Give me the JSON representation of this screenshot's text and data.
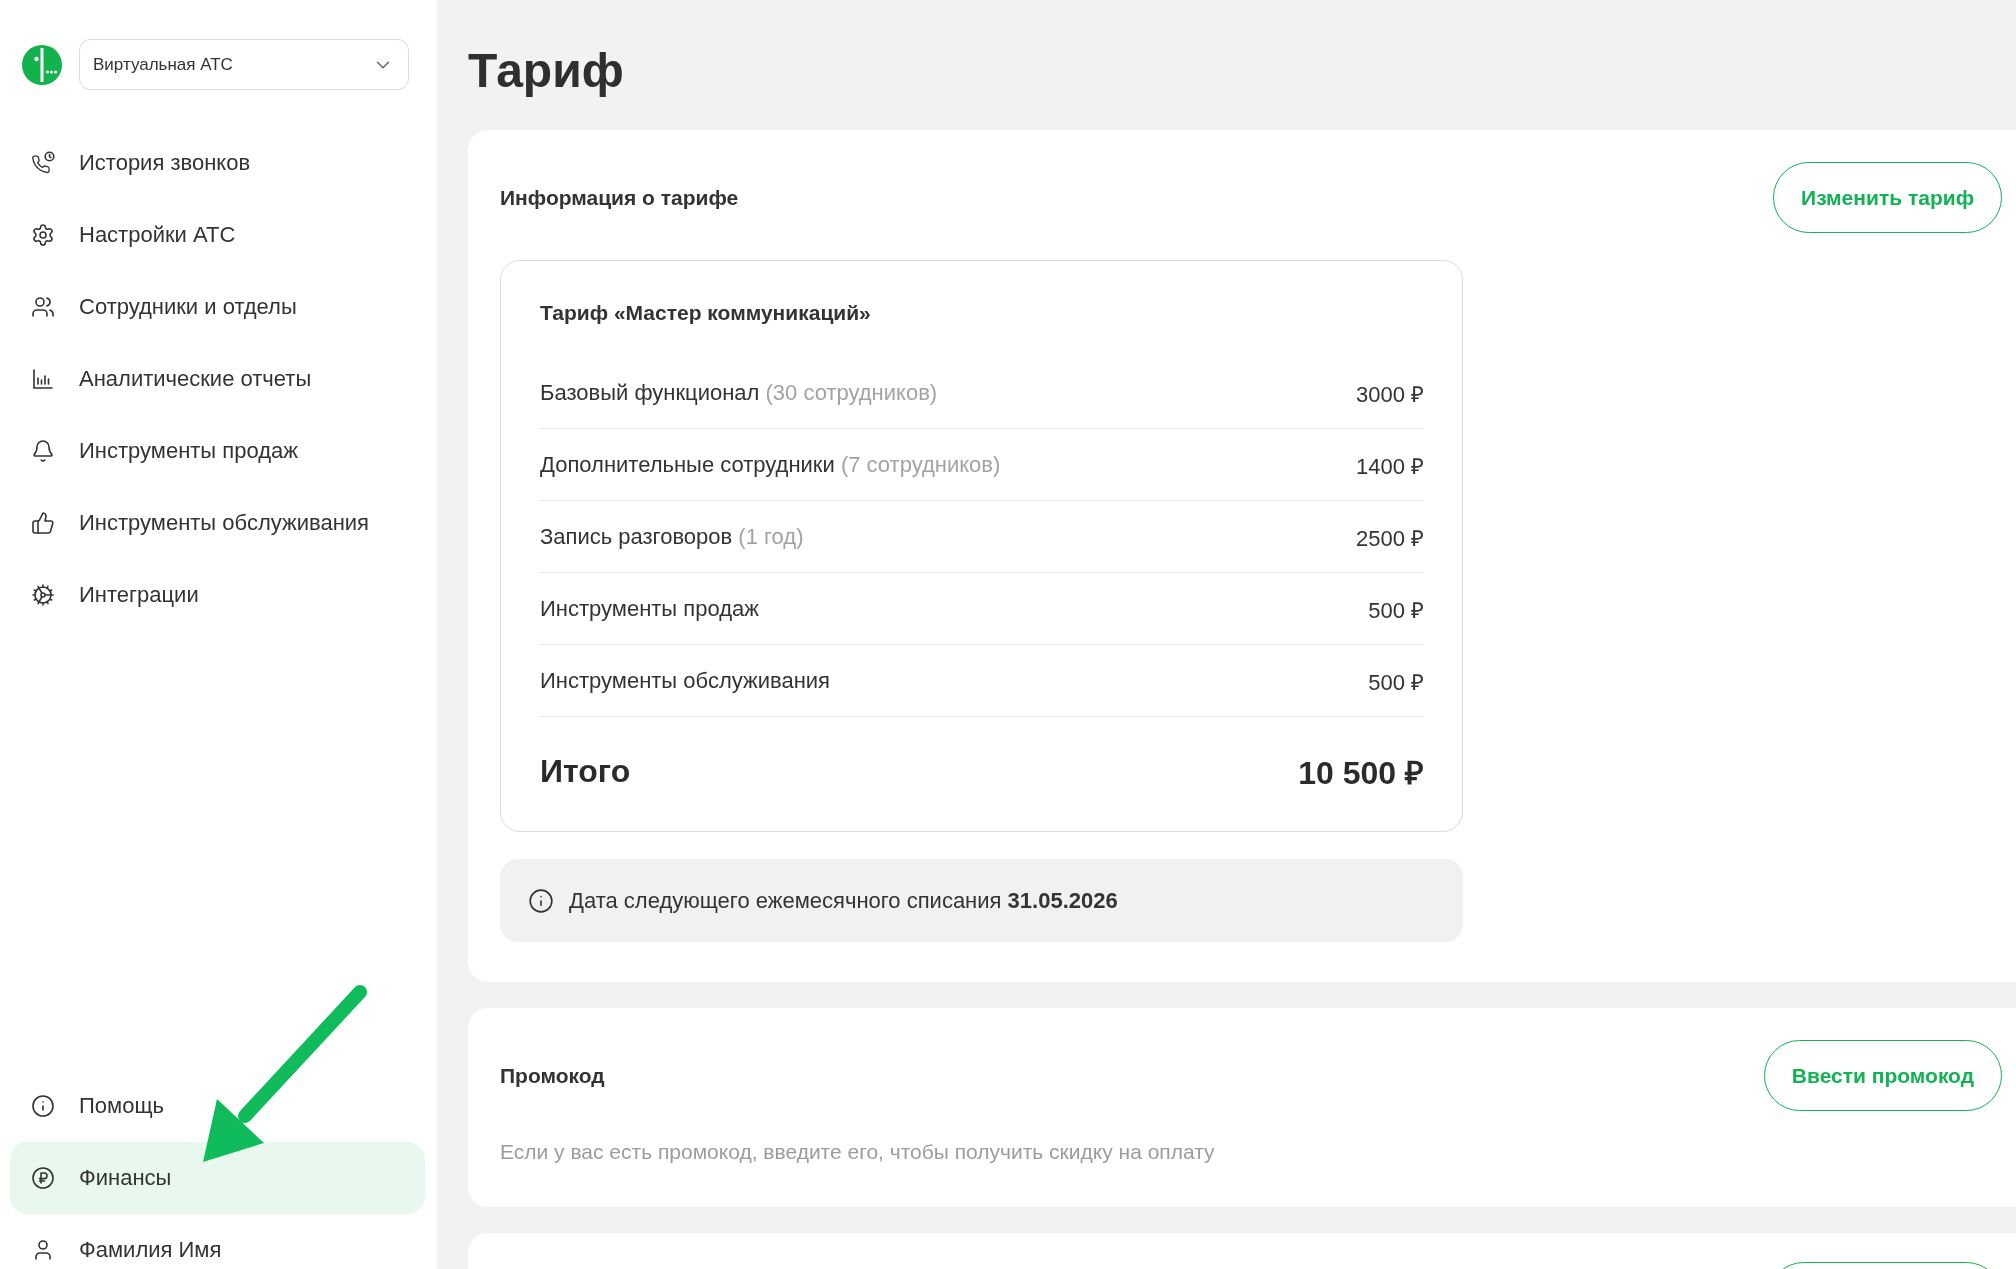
{
  "sidebar": {
    "product_selector": {
      "value": "Виртуальная АТС"
    },
    "nav_items": [
      {
        "label": "История звонков",
        "selected": false
      },
      {
        "label": "Настройки АТС",
        "selected": false
      },
      {
        "label": "Сотрудники и отделы",
        "selected": false
      },
      {
        "label": "Аналитические отчеты",
        "selected": false
      },
      {
        "label": "Инструменты продаж",
        "selected": false
      },
      {
        "label": "Инструменты обслуживания",
        "selected": false
      },
      {
        "label": "Интеграции",
        "selected": false
      }
    ],
    "footer_items": [
      {
        "label": "Помощь",
        "selected": false
      },
      {
        "label": "Финансы",
        "selected": true
      },
      {
        "label": "Фамилия Имя",
        "selected": false
      }
    ]
  },
  "page_title": "Тариф",
  "tariff_card": {
    "title": "Информация о тарифе",
    "button": "Изменить тариф",
    "plan": {
      "title": "Тариф «Мастер коммуникаций»",
      "items": [
        {
          "label": "Базовый функционал",
          "note": "(30 сотрудников)",
          "price": "3000 ₽"
        },
        {
          "label": "Дополнительные сотрудники",
          "note": "(7 сотрудников)",
          "price": "1400 ₽"
        },
        {
          "label": "Запись разговоров",
          "note": "(1 год)",
          "price": "2500 ₽"
        },
        {
          "label": "Инструменты продаж",
          "price": "500 ₽"
        },
        {
          "label": "Инструменты обслуживания",
          "price": "500 ₽"
        }
      ],
      "total": {
        "label": "Итого",
        "amount": "10 500 ₽"
      }
    },
    "notice": "Дата следующего ежемесячного списания **31.05.2026**"
  },
  "promo_card": {
    "title": "Промокод",
    "button": "Ввести промокод",
    "description": "Если у вас есть промокод, введите его, чтобы получить скидку на оплату"
  }
}
